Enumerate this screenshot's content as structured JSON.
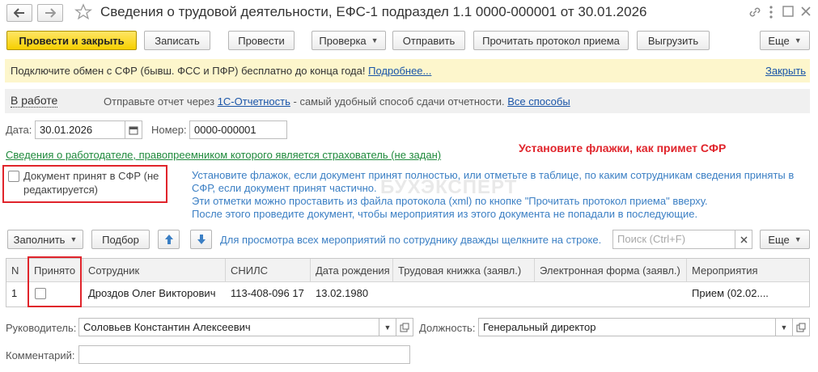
{
  "titlebar": {
    "back_icon": "arrow-left",
    "forward_icon": "arrow-right",
    "star_icon": "star-outline",
    "title": "Сведения о трудовой деятельности, ЕФС-1 подраздел 1.1 0000-000001 от 30.01.2026",
    "link_icon": "link",
    "menu_icon": "vertical-dots",
    "maximize_icon": "maximize",
    "close_icon": "close-x"
  },
  "toolbar": {
    "post_close": "Провести и закрыть",
    "save": "Записать",
    "post": "Провести",
    "check": "Проверка",
    "send": "Отправить",
    "read_protocol": "Прочитать протокол приема",
    "upload": "Выгрузить",
    "more": "Еще"
  },
  "banner": {
    "text": "Подключите обмен с СФР (бывш. ФСС и ПФР) бесплатно до конца года!",
    "more_link": "Подробнее...",
    "close_link": "Закрыть",
    "color": "#fdf6cc"
  },
  "status_bar": {
    "status": "В работе",
    "prefix": "Отправьте отчет через",
    "link": "1С-Отчетность",
    "suffix": "- самый удобный способ сдачи отчетности.",
    "all_ways": "Все способы"
  },
  "form": {
    "date_label": "Дата:",
    "date_value": "30.01.2026",
    "number_label": "Номер:",
    "number_value": "0000-000001",
    "employer_link": "Сведения о работодателе, правопреемником которого является страхователь (не задан)",
    "accepted_checkbox_label": "Документ принят в СФР (не редактируется)",
    "hint_lines": [
      "Установите флажок, если документ принят полностью, или отметьте в таблице, по каким сотрудникам сведения приняты в",
      "СФР, если документ принят частично.",
      "Эти отметки можно проставить из файла протокола (xml) по кнопке \"Прочитать протокол приема\" вверху.",
      "После этого проведите документ, чтобы мероприятия из этого документа не попадали в последующие."
    ],
    "annotation": "Установите флажки, как примет СФР",
    "watermark": "БУХЭКСПЕРТ"
  },
  "table_toolbar": {
    "fill": "Заполнить",
    "select": "Подбор",
    "up_icon": "arrow-up",
    "down_icon": "arrow-down",
    "hint": "Для просмотра всех мероприятий по сотруднику дважды щелкните на строке.",
    "search_placeholder": "Поиск (Ctrl+F)",
    "clear_icon": "close-x",
    "more": "Еще"
  },
  "table": {
    "columns": [
      "N",
      "Принято",
      "Сотрудник",
      "СНИЛС",
      "Дата рождения",
      "Трудовая книжка (заявл.)",
      "Электронная форма (заявл.)",
      "Мероприятия"
    ],
    "rows": [
      {
        "n": "1",
        "accepted": false,
        "employee": "Дроздов Олег Викторович",
        "snils": "113-408-096 17",
        "birth_date": "13.02.1980",
        "work_book": "",
        "e_form": "",
        "events": "Прием (02.02...."
      }
    ]
  },
  "footer": {
    "manager_label": "Руководитель:",
    "manager_value": "Соловьев Константин Алексеевич",
    "position_label": "Должность:",
    "position_value": "Генеральный директор",
    "comment_label": "Комментарий:",
    "comment_value": ""
  },
  "colors": {
    "accent_yellow": "#f6d000",
    "red_highlight": "#e0242b",
    "link_blue": "#1a55a8",
    "hint_blue": "#3b7fc4",
    "employer_link_green": "#1f8a3c"
  }
}
